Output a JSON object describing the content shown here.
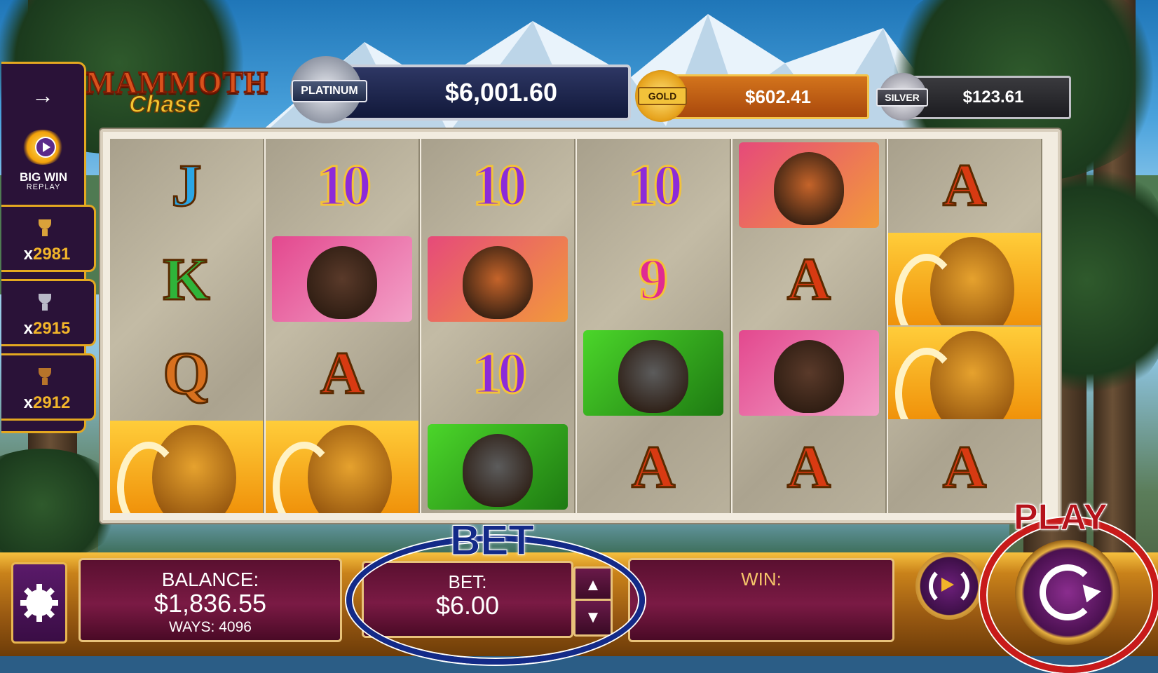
{
  "game": {
    "title_line1": "MAMMOTH",
    "title_line2": "Chase"
  },
  "jackpots": {
    "platinum": {
      "label": "PLATINUM",
      "amount": "$6,001.60"
    },
    "gold": {
      "label": "GOLD",
      "amount": "$602.41"
    },
    "silver": {
      "label": "SILVER",
      "amount": "$123.61"
    }
  },
  "sidebar": {
    "arrow": "→",
    "big_win_title": "BIG WIN",
    "big_win_subtitle": "REPLAY",
    "trophies": [
      {
        "prefix": "x",
        "count": "2981",
        "color": "#d9a23a"
      },
      {
        "prefix": "x",
        "count": "2915",
        "color": "#b9b9c8"
      },
      {
        "prefix": "x",
        "count": "2912",
        "color": "#b7742a"
      }
    ]
  },
  "reels": [
    [
      "J",
      "K",
      "Q",
      "mammoth"
    ],
    [
      "10",
      "elk",
      "A",
      "mammoth"
    ],
    [
      "10",
      "sabertooth",
      "10",
      "wolf"
    ],
    [
      "10",
      "9",
      "wolf",
      "A"
    ],
    [
      "sabertooth",
      "A",
      "elk",
      "A"
    ],
    [
      "A",
      "mammoth",
      "mammoth",
      "A"
    ]
  ],
  "controls": {
    "balance_label": "BALANCE:",
    "balance_value": "$1,836.55",
    "ways_label": "WAYS: 4096",
    "bet_label": "BET:",
    "bet_value": "$6.00",
    "bet_up": "▲",
    "bet_down": "▼",
    "win_label": "WIN:",
    "win_value": ""
  },
  "annotations": {
    "bet": "BET",
    "play": "PLAY"
  }
}
